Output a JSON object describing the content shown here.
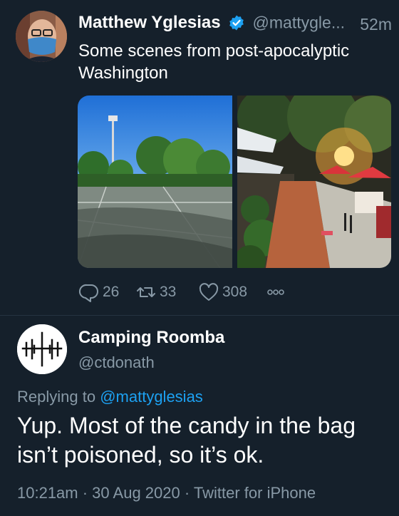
{
  "tweet": {
    "author_name": "Matthew Yglesias",
    "author_handle": "@mattygle...",
    "time": "52m",
    "text": "Some scenes from post-apocalyptic Washington",
    "actions": {
      "replies": "26",
      "retweets": "33",
      "likes": "308"
    }
  },
  "reply": {
    "author_name": "Camping Roomba",
    "author_handle": "@ctdonath",
    "replying_prefix": "Replying to",
    "replying_to": "@mattyglesias",
    "text": "Yup. Most of the candy in the bag isn’t poisoned, so it’s ok.",
    "timestamp": "10:21am · 30 Aug 2020 · Twitter for iPhone"
  },
  "icons": [
    "verified-icon",
    "reply-icon",
    "retweet-icon",
    "like-icon",
    "more-icon"
  ],
  "colors": {
    "background": "#15202b",
    "secondary_text": "#8899a6",
    "accent": "#1da1f2"
  }
}
